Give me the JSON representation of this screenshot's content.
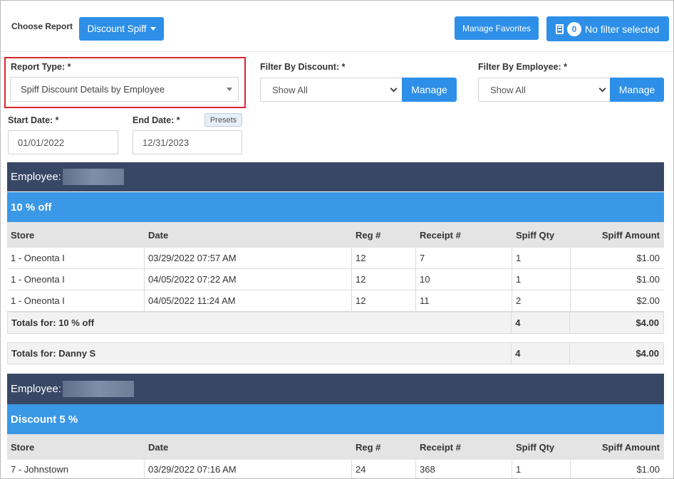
{
  "header": {
    "choose_report_label": "Choose Report",
    "report_dropdown": "Discount Spiff",
    "manage_favorites": "Manage Favorites",
    "filter_count": "0",
    "filter_text": "No filter selected"
  },
  "filters": {
    "report_type_label": "Report Type: *",
    "report_type_value": "Spiff Discount Details by Employee",
    "discount_label": "Filter By Discount: *",
    "discount_value": "Show All",
    "discount_manage": "Manage",
    "employee_label": "Filter By Employee: *",
    "employee_value": "Show All",
    "employee_manage": "Manage",
    "start_date_label": "Start Date: *",
    "start_date_value": "01/01/2022",
    "end_date_label": "End Date: *",
    "end_date_value": "12/31/2023",
    "presets": "Presets"
  },
  "columns": [
    "Store",
    "Date",
    "Reg #",
    "Receipt #",
    "Spiff Qty",
    "Spiff Amount"
  ],
  "groups": [
    {
      "employee_label": "Employee:",
      "discount_name": "10 % off",
      "rows": [
        [
          "1 - Oneonta I",
          "03/29/2022 07:57 AM",
          "12",
          "7",
          "1",
          "$1.00"
        ],
        [
          "1 - Oneonta I",
          "04/05/2022 07:22 AM",
          "12",
          "10",
          "1",
          "$1.00"
        ],
        [
          "1 - Oneonta I",
          "04/05/2022 11:24 AM",
          "12",
          "11",
          "2",
          "$2.00"
        ]
      ],
      "discount_total_label": "Totals for: 10 % off",
      "discount_total_qty": "4",
      "discount_total_amount": "$4.00",
      "employee_total_label": "Totals for: Danny S",
      "employee_total_qty": "4",
      "employee_total_amount": "$4.00"
    },
    {
      "employee_label": "Employee:",
      "discount_name": "Discount 5 %",
      "rows": [
        [
          "7 - Johnstown",
          "03/29/2022 07:16 AM",
          "24",
          "368",
          "1",
          "$1.00"
        ]
      ]
    }
  ],
  "colors": {
    "accent_blue": "#2d8fe8",
    "employee_bar": "#384765",
    "discount_bar": "#3a98e6",
    "highlight_red": "#d9262c"
  }
}
